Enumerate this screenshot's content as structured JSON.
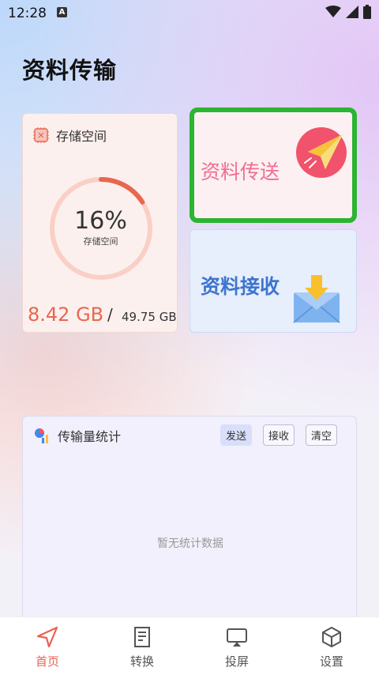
{
  "status": {
    "time": "12:28",
    "badge": "A"
  },
  "header": {
    "title": "资料传输"
  },
  "storage": {
    "title": "存储空间",
    "percent_text": "16%",
    "percent_value": 0.16,
    "ring_label": "存储空间",
    "used": "8.42 GB",
    "separator": "/",
    "total": "49.75 GB"
  },
  "send": {
    "label": "资料传送"
  },
  "receive": {
    "label": "资料接收"
  },
  "stats": {
    "title": "传输量统计",
    "buttons": {
      "send": "发送",
      "receive": "接收",
      "clear": "清空"
    },
    "empty_text": "暂无统计数据"
  },
  "nav": [
    {
      "label": "首页",
      "icon": "send-arrow-icon",
      "active": true
    },
    {
      "label": "转换",
      "icon": "document-icon",
      "active": false
    },
    {
      "label": "投屏",
      "icon": "cast-screen-icon",
      "active": false
    },
    {
      "label": "设置",
      "icon": "cube-icon",
      "active": false
    }
  ],
  "colors": {
    "accent": "#e86150",
    "send_text": "#ef6e92",
    "receive_text": "#3e75cf",
    "highlight_border": "#2cb433"
  }
}
